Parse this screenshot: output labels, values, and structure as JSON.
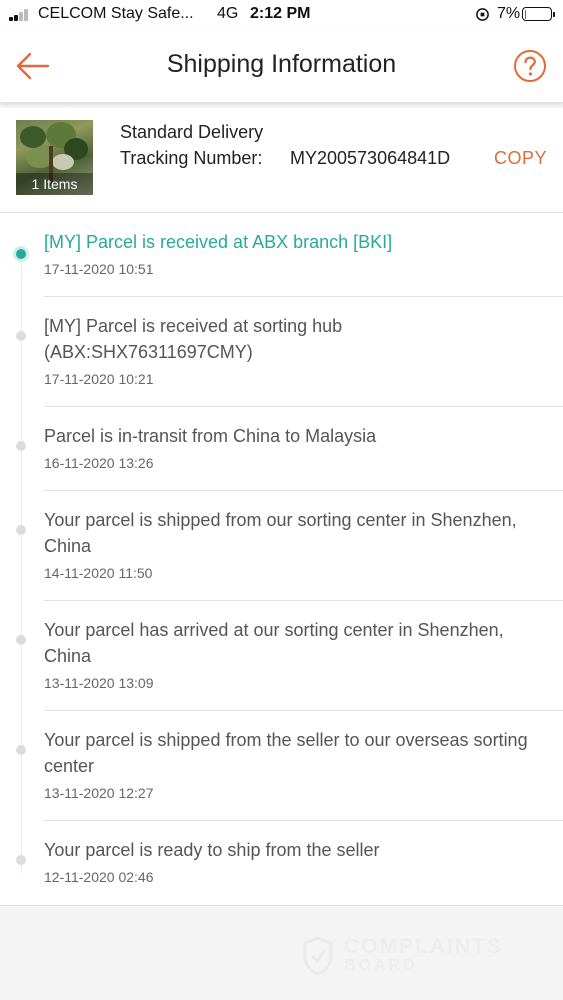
{
  "status_bar": {
    "carrier": "CELCOM Stay Safe...",
    "network": "4G",
    "time": "2:12 PM",
    "battery_percent": "7%",
    "battery_level": 0.07,
    "battery_color": "#e0372e"
  },
  "nav": {
    "title": "Shipping Information",
    "back_icon": "arrow-left-icon",
    "help_icon": "question-circle-icon",
    "accent_color": "#e06a3c"
  },
  "summary": {
    "thumbnail_caption": "1 Items",
    "delivery_type": "Standard Delivery",
    "tracking_label": "Tracking Number:",
    "tracking_number": "MY200573064841D",
    "copy_label": "COPY"
  },
  "timeline": {
    "active_color": "#26aa99",
    "events": [
      {
        "text": "[MY] Parcel is received at ABX branch [BKI]",
        "time": "17-11-2020 10:51",
        "active": true
      },
      {
        "text": "[MY] Parcel is received at sorting hub (ABX:SHX76311697CMY)",
        "time": "17-11-2020 10:21",
        "active": false
      },
      {
        "text": "Parcel is in-transit from China to Malaysia",
        "time": "16-11-2020 13:26",
        "active": false
      },
      {
        "text": "Your parcel is shipped from our sorting center in Shenzhen, China",
        "time": "14-11-2020 11:50",
        "active": false
      },
      {
        "text": "Your parcel has arrived at our sorting center in Shenzhen, China",
        "time": "13-11-2020 13:09",
        "active": false
      },
      {
        "text": "Your parcel is shipped from the seller to our overseas sorting center",
        "time": "13-11-2020 12:27",
        "active": false
      },
      {
        "text": "Your parcel is ready to ship from the seller",
        "time": "12-11-2020 02:46",
        "active": false
      }
    ]
  },
  "watermark": {
    "line1": "COMPLAINTS",
    "line2": "BOARD"
  }
}
